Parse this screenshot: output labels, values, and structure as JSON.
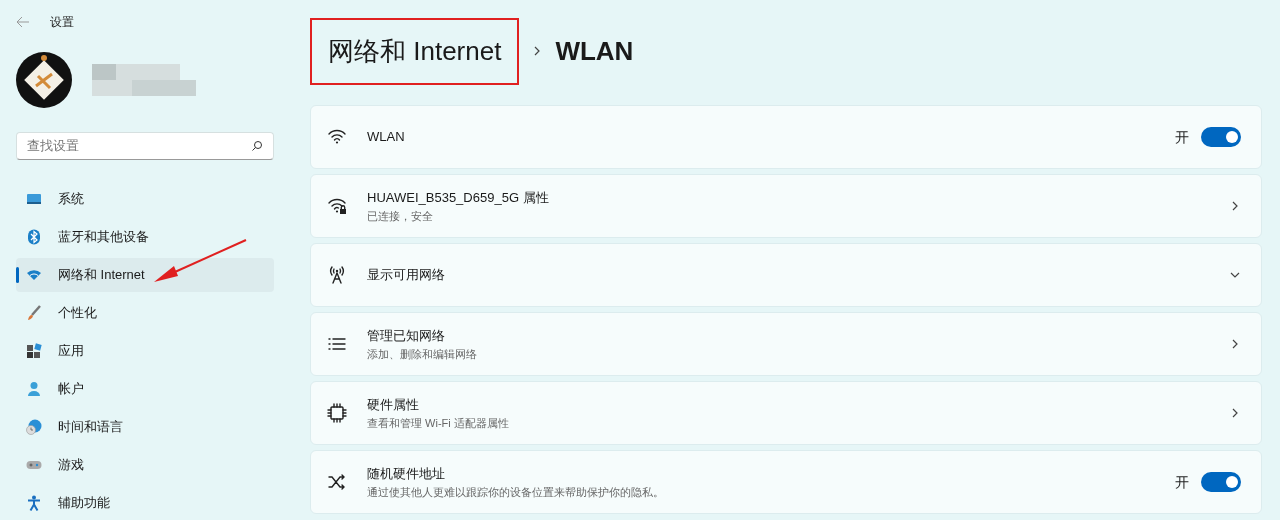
{
  "window": {
    "title": "设置"
  },
  "search": {
    "placeholder": "查找设置"
  },
  "sidebar": {
    "items": [
      {
        "label": "系统",
        "selected": false
      },
      {
        "label": "蓝牙和其他设备",
        "selected": false
      },
      {
        "label": "网络和 Internet",
        "selected": true
      },
      {
        "label": "个性化",
        "selected": false
      },
      {
        "label": "应用",
        "selected": false
      },
      {
        "label": "帐户",
        "selected": false
      },
      {
        "label": "时间和语言",
        "selected": false
      },
      {
        "label": "游戏",
        "selected": false
      },
      {
        "label": "辅助功能",
        "selected": false
      }
    ]
  },
  "breadcrumb": {
    "parent": "网络和 Internet",
    "current": "WLAN"
  },
  "rows": [
    {
      "kind": "toggle",
      "title": "WLAN",
      "state_label": "开",
      "on": true
    },
    {
      "kind": "link",
      "title": "HUAWEI_B535_D659_5G 属性",
      "subtitle": "已连接，安全"
    },
    {
      "kind": "expand",
      "title": "显示可用网络"
    },
    {
      "kind": "link",
      "title": "管理已知网络",
      "subtitle": "添加、删除和编辑网络"
    },
    {
      "kind": "link",
      "title": "硬件属性",
      "subtitle": "查看和管理 Wi-Fi 适配器属性"
    },
    {
      "kind": "toggle",
      "title": "随机硬件地址",
      "subtitle": "通过使其他人更难以跟踪你的设备位置来帮助保护你的隐私。",
      "state_label": "开",
      "on": true
    }
  ]
}
